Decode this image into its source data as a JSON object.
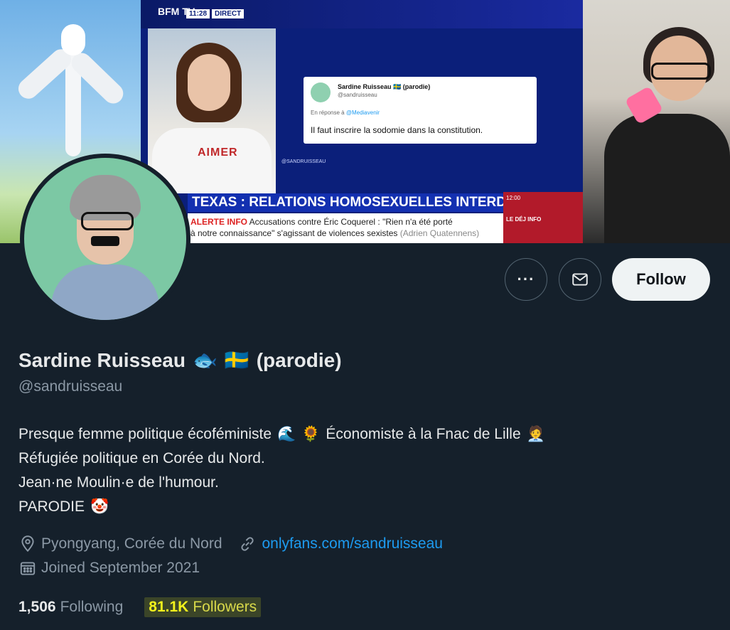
{
  "banner": {
    "bfm_logo": "BFM TV.",
    "bfm_time": "11:28",
    "bfm_direct": "DIRECT",
    "tv_shirt_text": "AIMER",
    "tweet_card": {
      "name": "Sardine Ruisseau 🇸🇪 (parodie)",
      "handle": "@sandruisseau",
      "reply_prefix": "En réponse à",
      "reply_to": "@Mediavenir",
      "text": "Il faut inscrire la sodomie dans la constitution."
    },
    "tv_handle": "@SANDRUISSEAU",
    "headline": "TEXAS : RELATIONS HOMOSEXUELLES INTERDITES ?",
    "ticker_label": "ALERTE INFO",
    "ticker_line1": "Accusations contre Éric Coquerel : \"Rien n'a été porté",
    "ticker_line2": "à notre connaissance\" s'agissant de violences sexistes",
    "ticker_author": "(Adrien Quatennens)",
    "deji_label": "LE DÉJ INFO",
    "deji_time": "12:00"
  },
  "profile": {
    "name": "Sardine Ruisseau",
    "name_emoji_fish": "🐟",
    "name_flag": "🇸🇪",
    "name_suffix": "(parodie)",
    "handle": "@sandruisseau",
    "bio_line1": "Presque femme politique écoféministe",
    "bio_emoji_wave": "🌊",
    "bio_emoji_sunflower": "🌻",
    "bio_line1_b": "Économiste à la Fnac de Lille",
    "bio_emoji_cashier": "🧑‍💼",
    "bio_line2": "Réfugiée politique en Corée du Nord.",
    "bio_line3": "Jean·ne Moulin·e de l'humour.",
    "bio_line4": "PARODIE",
    "bio_emoji_clown": "🤡",
    "location": "Pyongyang, Corée du Nord",
    "website": "onlyfans.com/sandruisseau",
    "joined": "Joined September 2021",
    "following_count": "1,506",
    "following_label": "Following",
    "followers_count": "81.1K",
    "followers_label": "Followers"
  },
  "actions": {
    "more_label": "···",
    "follow_label": "Follow"
  },
  "colors": {
    "background": "#15202b",
    "accent": "#1d9bf0",
    "secondary_text": "#8b98a5",
    "highlight": "#f2f21c"
  },
  "icons": [
    "more-icon",
    "mail-icon",
    "location-pin-icon",
    "link-icon",
    "calendar-icon"
  ]
}
